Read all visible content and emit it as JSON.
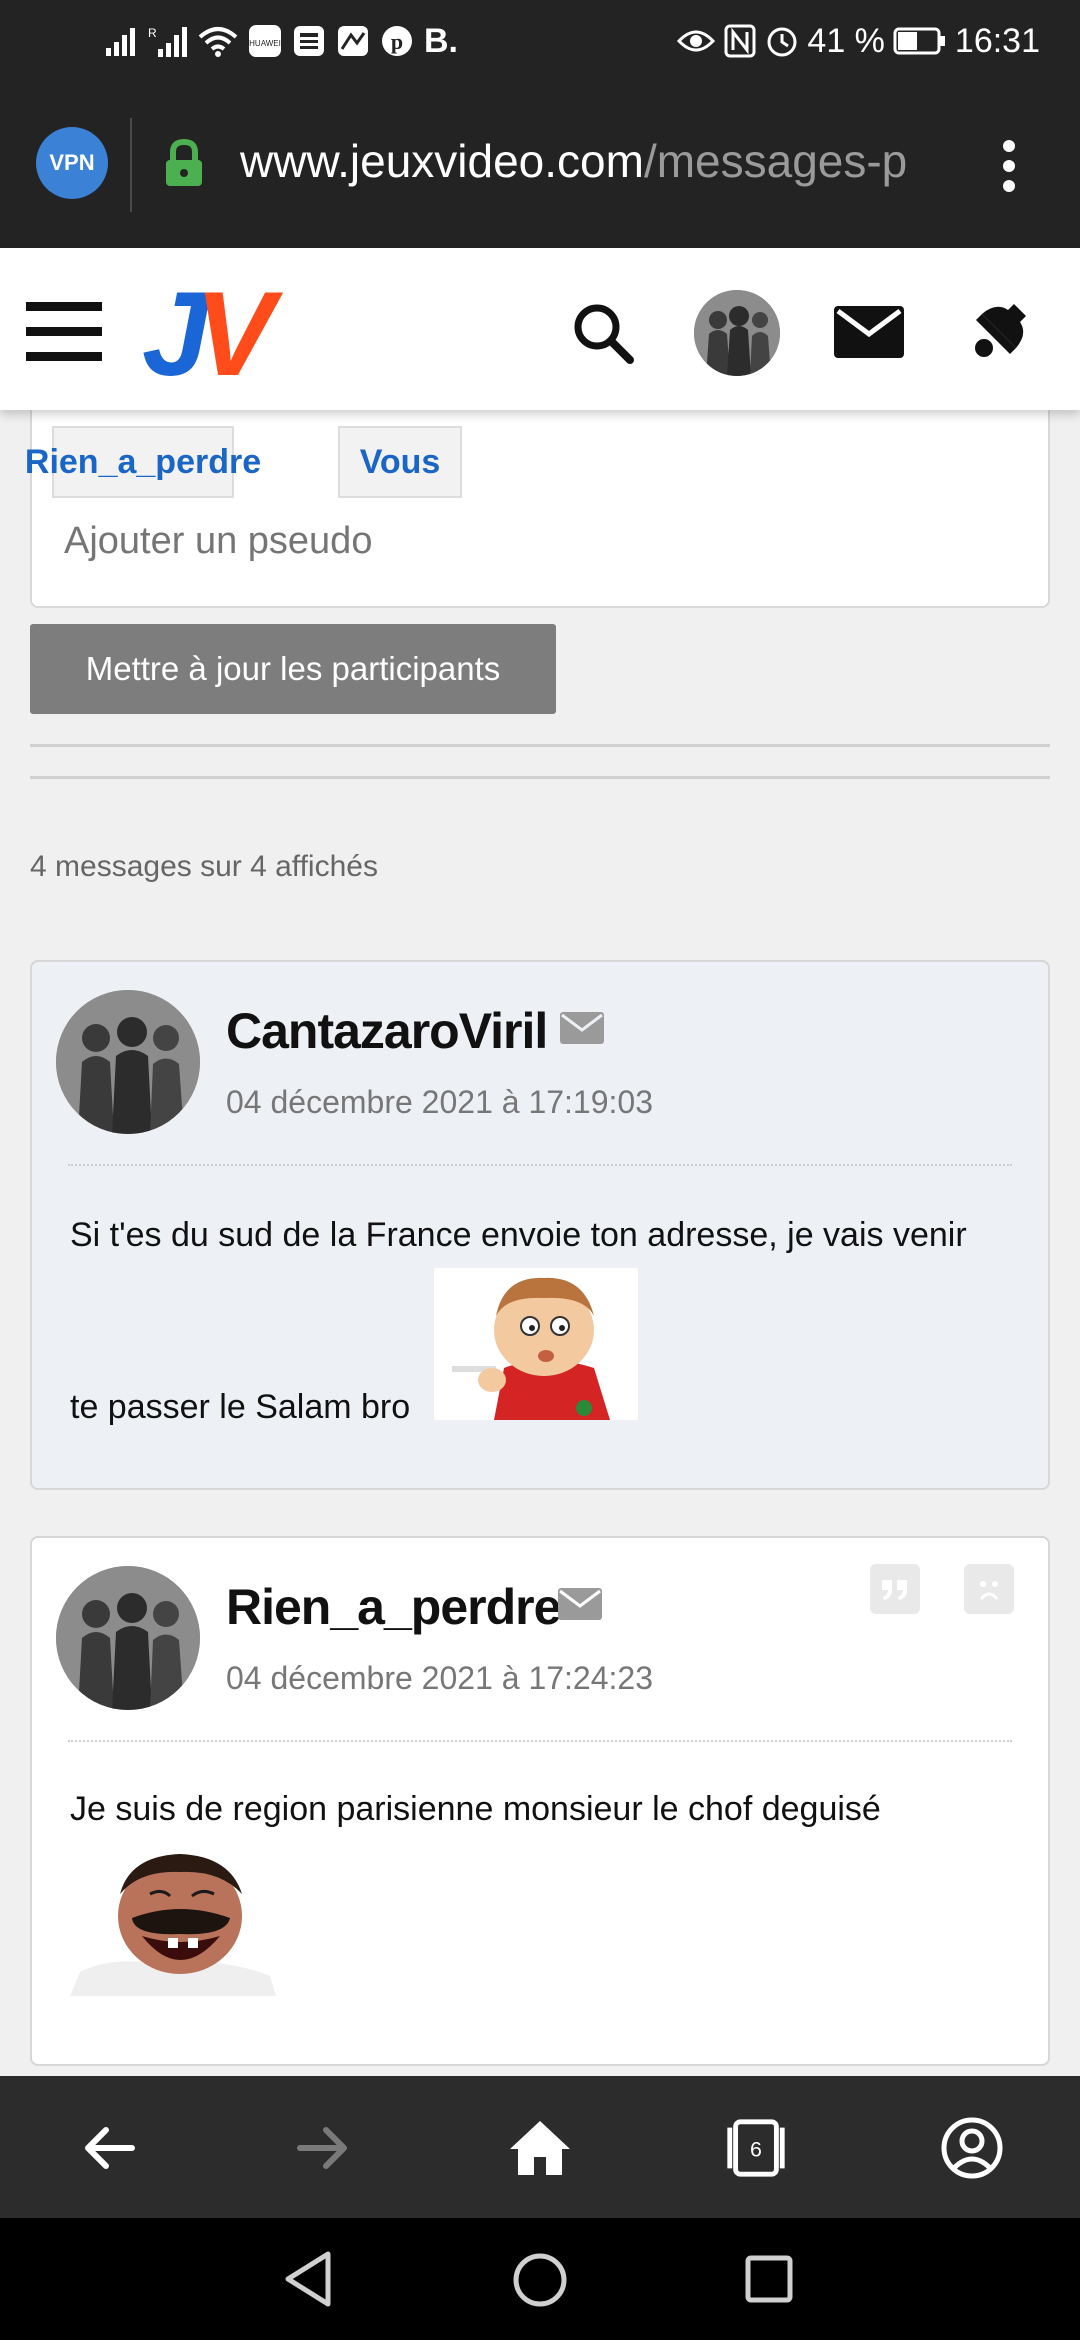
{
  "status_bar": {
    "left_icons": [
      "signal-icon",
      "signal-roaming-icon",
      "wifi-icon",
      "huawei-icon",
      "news-icon",
      "gallery-icon",
      "pinterest-icon",
      "booking-icon"
    ],
    "booking_label": "B.",
    "battery_percent": "41 %",
    "time": "16:31"
  },
  "browser": {
    "vpn_label": "VPN",
    "url_host": "www.jeuxvideo.com",
    "url_path": "/messages-p",
    "tab_count": "6"
  },
  "participants": {
    "chips": [
      "Rien_a_perdre",
      "Vous"
    ],
    "add_placeholder": "Ajouter un pseudo",
    "update_button": "Mettre à jour les participants"
  },
  "message_count": "4 messages sur 4 affichés",
  "posts": [
    {
      "author": "CantazaroViril",
      "date": "04 décembre 2021 à 17:19:03",
      "line1": "Si t'es du sud de la France envoie ton adresse, je vais venir",
      "line2": "te passer le Salam bro"
    },
    {
      "author": "Rien_a_perdre",
      "date": "04 décembre 2021 à 17:24:23",
      "line1": "Je suis de region parisienne monsieur le chof deguisé"
    }
  ],
  "colors": {
    "jv_blue": "#1a66d6",
    "jv_orange": "#ff4c1a",
    "chip_text": "#1a66c6",
    "post_highlight_bg": "#edf0f5"
  }
}
